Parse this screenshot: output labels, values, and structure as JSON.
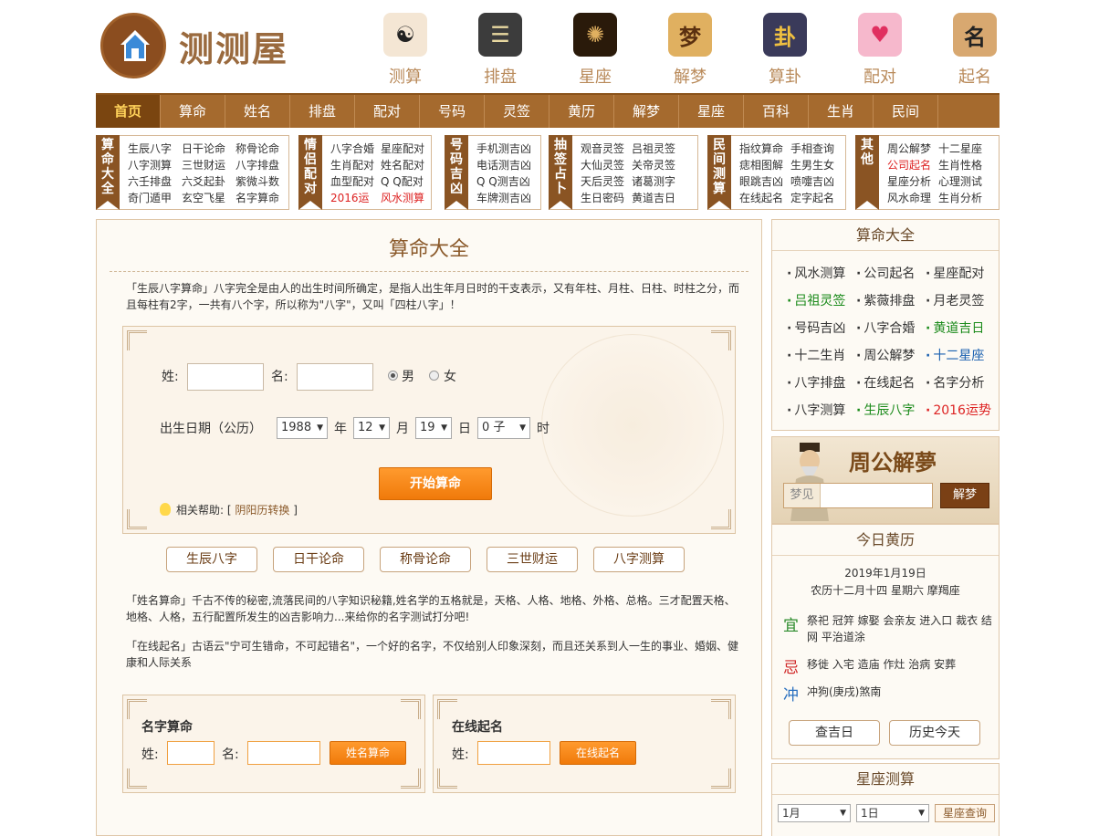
{
  "logo": {
    "text": "测测屋"
  },
  "topnav": [
    {
      "label": "测算",
      "icon": "yin-yang-icon",
      "glyph": "☯",
      "bg": "#f4e6d4",
      "fg": "#222"
    },
    {
      "label": "排盘",
      "icon": "bagua-icon",
      "glyph": "☰",
      "bg": "#3c3c3c",
      "fg": "#e8d8a0"
    },
    {
      "label": "星座",
      "icon": "compass-icon",
      "glyph": "✺",
      "bg": "#2a1a0a",
      "fg": "#e0b060"
    },
    {
      "label": "解梦",
      "icon": "zhougong-icon",
      "glyph": "梦",
      "bg": "#e0b060",
      "fg": "#5a3010"
    },
    {
      "label": "算卦",
      "icon": "fortune-sticks-icon",
      "glyph": "卦",
      "bg": "#3a3a5a",
      "fg": "#f0c040"
    },
    {
      "label": "配对",
      "icon": "couple-heart-icon",
      "glyph": "♥",
      "bg": "#f6b8cc",
      "fg": "#e03060"
    },
    {
      "label": "起名",
      "icon": "name-icon",
      "glyph": "名",
      "bg": "#d8a870",
      "fg": "#222"
    }
  ],
  "mainnav": [
    "首页",
    "算命",
    "姓名",
    "排盘",
    "配对",
    "号码",
    "灵签",
    "黄历",
    "解梦",
    "星座",
    "百科",
    "生肖",
    "民间"
  ],
  "categories": [
    {
      "tag": "算命大全",
      "cols": 3,
      "links": [
        "生辰八字",
        "日干论命",
        "称骨论命",
        "八字测算",
        "三世财运",
        "八字排盘",
        "六壬排盘",
        "六爻起卦",
        "紫微斗数",
        "奇门遁甲",
        "玄空飞星",
        "名字算命"
      ]
    },
    {
      "tag": "情侣配对",
      "cols": 2,
      "links": [
        "八字合婚",
        "星座配对",
        "生肖配对",
        "姓名配对",
        "血型配对",
        "Q Q配对",
        "2016运",
        "风水测算"
      ]
    },
    {
      "tag": "号码吉凶",
      "cols": 1,
      "links": [
        "手机测吉凶",
        "电话测吉凶",
        "Q Q测吉凶",
        "车牌测吉凶"
      ]
    },
    {
      "tag": "抽签占卜",
      "cols": 2,
      "links": [
        "观音灵签",
        "吕祖灵签",
        "大仙灵签",
        "关帝灵签",
        "天后灵签",
        "诸葛测字",
        "生日密码",
        "黄道吉日"
      ]
    },
    {
      "tag": "民间测算",
      "cols": 2,
      "links": [
        "指纹算命",
        "手相查询",
        "痣相图解",
        "生男生女",
        "眼跳吉凶",
        "喷嚏吉凶",
        "在线起名",
        "定字起名"
      ]
    },
    {
      "tag": "其他",
      "cols": 2,
      "links": [
        "周公解梦",
        "十二星座",
        "公司起名",
        "生肖性格",
        "星座分析",
        "心理测试",
        "风水命理",
        "生肖分析"
      ]
    }
  ],
  "main": {
    "title": "算命大全",
    "intro": "「生辰八字算命」八字完全是由人的出生时间所确定，是指人出生年月日时的干支表示，又有年柱、月柱、日柱、时柱之分，而且每柱有2字，一共有八个字，所以称为\"八字\"，又叫「四柱八字」！",
    "form": {
      "surname_label": "姓:",
      "name_label": "名:",
      "male": "男",
      "female": "女",
      "birth_label": "出生日期（公历）",
      "year": "1988",
      "year_unit": "年",
      "month": "12",
      "month_unit": "月",
      "day": "19",
      "day_unit": "日",
      "hour": "0 子",
      "hour_unit": "时",
      "submit": "开始算命",
      "help_label": "相关帮助:",
      "help_link": "阴阳历转换"
    },
    "quicktabs": [
      "生辰八字",
      "日干论命",
      "称骨论命",
      "三世财运",
      "八字测算"
    ],
    "para2": "「姓名算命」千古不传的秘密,流落民间的八字知识秘籍,姓名学的五格就是，天格、人格、地格、外格、总格。三才配置天格、地格、人格，五行配置所发生的凶吉影响力...来给你的名字测试打分吧!",
    "para3": "「在线起名」古语云\"宁可生错命，不可起错名\"，一个好的名字，不仅给别人印象深刻，而且还关系到人一生的事业、婚姻、健康和人际关系",
    "name_box": {
      "title": "名字算命",
      "surname": "姓:",
      "name": "名:",
      "button": "姓名算命"
    },
    "qiming_box": {
      "title": "在线起名",
      "surname": "姓:",
      "button": "在线起名"
    }
  },
  "sidebar": {
    "title": "算命大全",
    "links": [
      {
        "t": "风水测算",
        "c": "dark"
      },
      {
        "t": "公司起名",
        "c": "dark"
      },
      {
        "t": "星座配对",
        "c": "dark"
      },
      {
        "t": "吕祖灵签",
        "c": "green"
      },
      {
        "t": "紫薇排盘",
        "c": "dark"
      },
      {
        "t": "月老灵签",
        "c": "dark"
      },
      {
        "t": "号码吉凶",
        "c": "dark"
      },
      {
        "t": "八字合婚",
        "c": "dark"
      },
      {
        "t": "黄道吉日",
        "c": "green"
      },
      {
        "t": "十二生肖",
        "c": "dark"
      },
      {
        "t": "周公解梦",
        "c": "dark"
      },
      {
        "t": "十二星座",
        "c": "blue"
      },
      {
        "t": "八字排盘",
        "c": "dark"
      },
      {
        "t": "在线起名",
        "c": "dark"
      },
      {
        "t": "名字分析",
        "c": "dark"
      },
      {
        "t": "八字测算",
        "c": "dark"
      },
      {
        "t": "生辰八字",
        "c": "green"
      },
      {
        "t": "2016运势",
        "c": "red"
      }
    ],
    "dream": {
      "title": "周公解夢",
      "input_label": "梦见",
      "button": "解梦"
    },
    "almanac": {
      "title": "今日黄历",
      "date": "2019年1月19日",
      "lunar": "农历十二月十四 星期六 摩羯座",
      "yi_label": "宜",
      "yi": "祭祀 冠笄 嫁娶 会亲友 进入口 裁衣 结网 平治道涂",
      "ji_label": "忌",
      "ji": "移徙 入宅 造庙 作灶 治病 安葬",
      "chong_label": "冲",
      "chong": "冲狗(庚戌)煞南",
      "btn_check": "查吉日",
      "btn_history": "历史今天"
    },
    "zodiac": {
      "title": "星座测算",
      "month": "1月",
      "day": "1日",
      "button": "星座查询"
    }
  }
}
